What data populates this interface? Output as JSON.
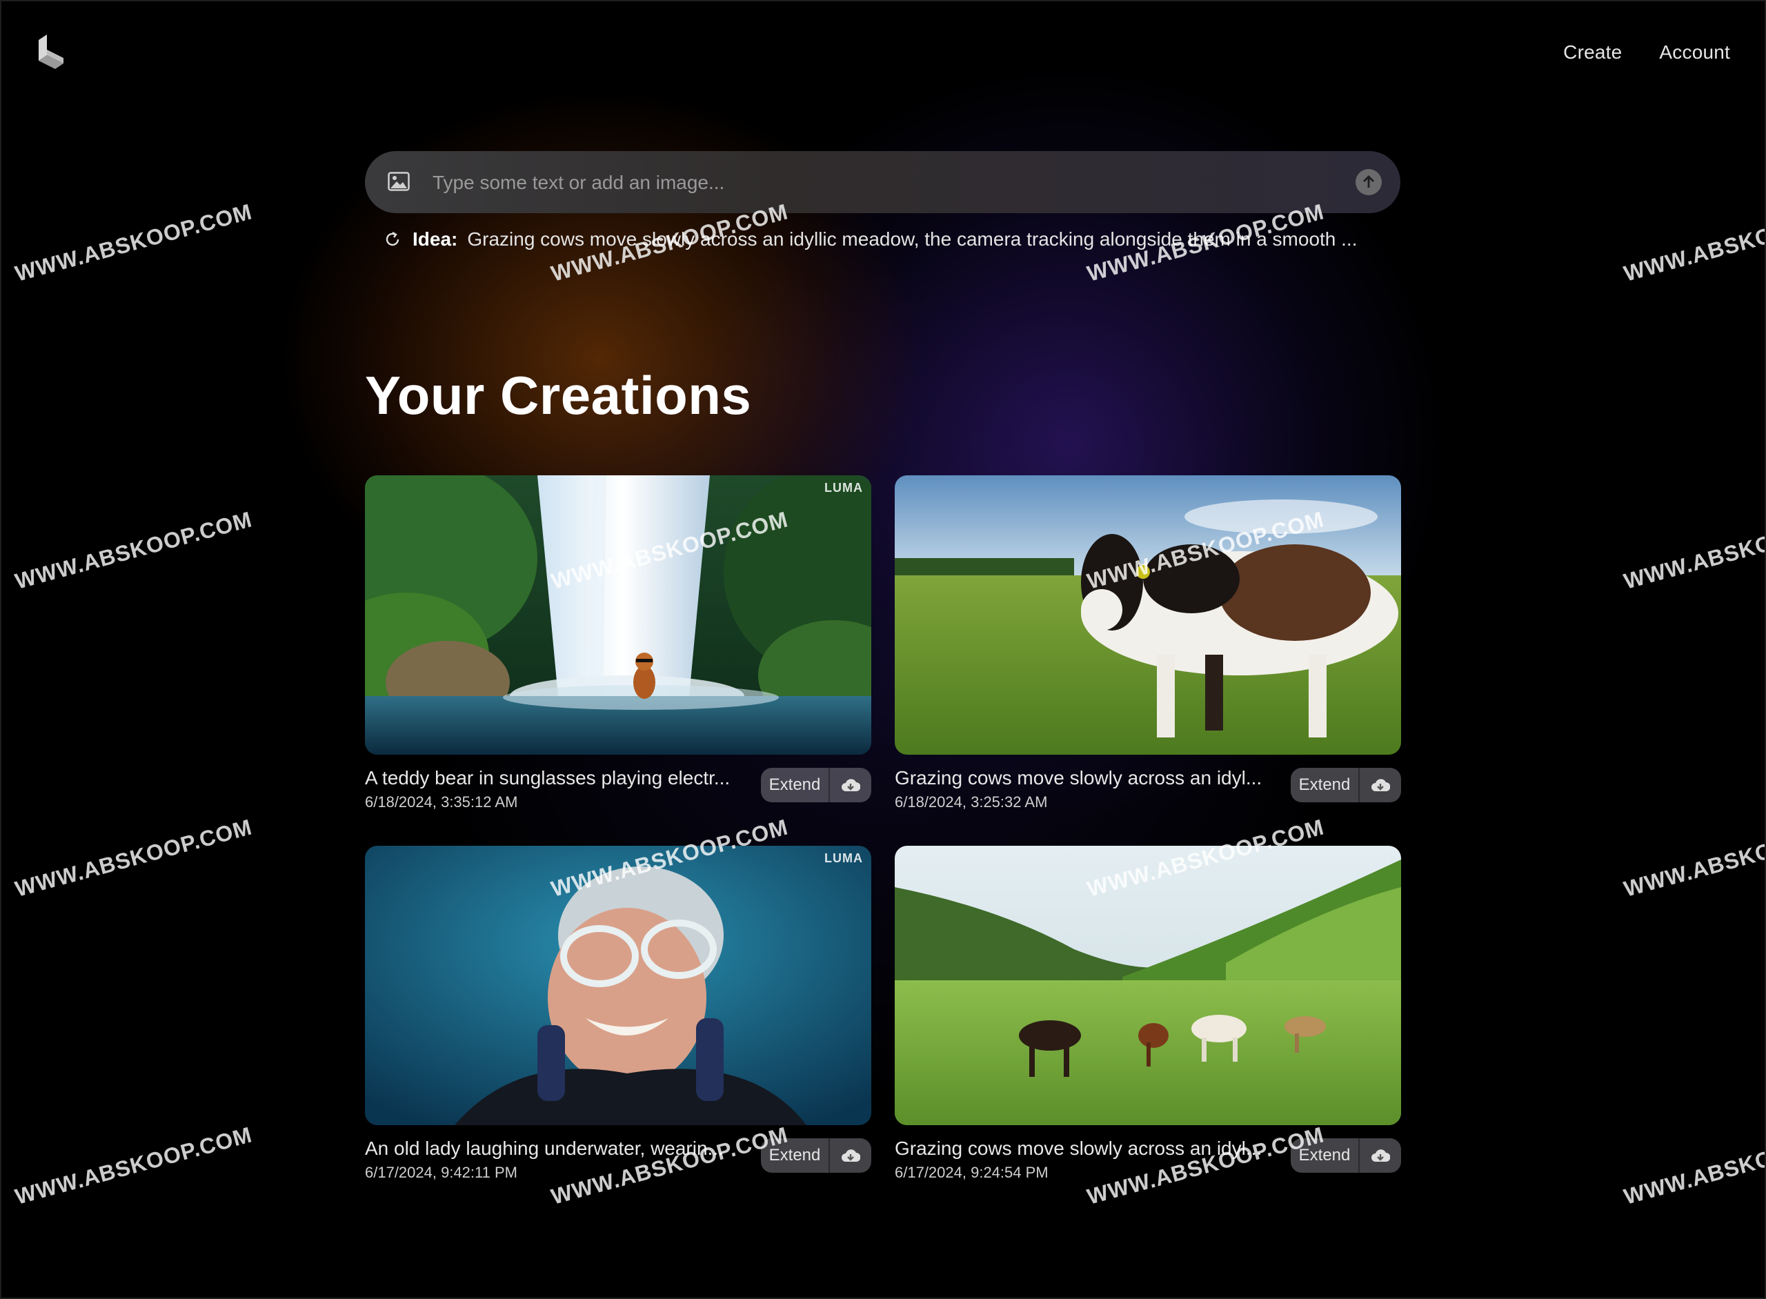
{
  "nav": {
    "create_label": "Create",
    "account_label": "Account"
  },
  "prompt": {
    "placeholder": "Type some text or add an image..."
  },
  "idea": {
    "label": "Idea:",
    "text": "Grazing cows move slowly across an idyllic meadow, the camera tracking alongside them in a smooth ..."
  },
  "section_title": "Your Creations",
  "creations": [
    {
      "title": "A teddy bear in sunglasses playing electr...",
      "date": "6/18/2024, 3:35:12 AM",
      "extend_label": "Extend",
      "badge": "LUMA"
    },
    {
      "title": "Grazing cows move slowly across an idyl...",
      "date": "6/18/2024, 3:25:32 AM",
      "extend_label": "Extend",
      "badge": ""
    },
    {
      "title": "An old lady laughing underwater, wearin...",
      "date": "6/17/2024, 9:42:11 PM",
      "extend_label": "Extend",
      "badge": "LUMA"
    },
    {
      "title": "Grazing cows move slowly across an idyl...",
      "date": "6/17/2024, 9:24:54 PM",
      "extend_label": "Extend",
      "badge": ""
    }
  ],
  "watermark": "WWW.ABSKOOP.COM",
  "colors": {
    "background": "#000000",
    "glow_warm": "#96480a",
    "glow_cool": "#3c1e8c"
  }
}
